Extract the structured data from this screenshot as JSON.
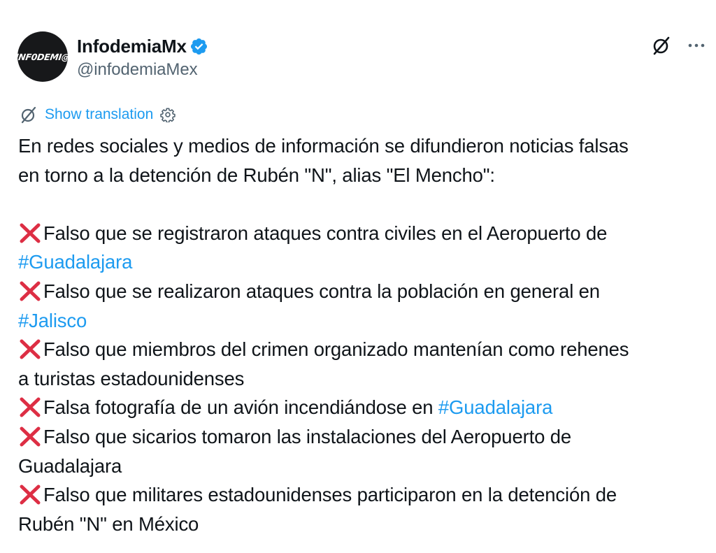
{
  "author": {
    "display_name": "InfodemiaMx",
    "handle": "@infodemiaMex",
    "avatar_text": "INF0DEMI@",
    "verified": true,
    "verified_icon": "verified-badge-icon",
    "verified_color": "#1d9bf0"
  },
  "actions": {
    "grok_icon": "grok-slash-circle-icon",
    "more_icon": "more-horizontal-icon"
  },
  "translation": {
    "label": "Show translation",
    "icon": "translate-slash-circle-icon",
    "settings_icon": "gear-icon",
    "color": "#1d9bf0"
  },
  "post": {
    "intro_line1": "En redes sociales y medios de información se difundieron noticias falsas",
    "intro_line2": "en torno a la detención de Rubén \"N\", alias \"El Mencho\":",
    "items": [
      {
        "line1": "Falso que se registraron ataques contra civiles en el Aeropuerto de",
        "hashtag_line2": "#Guadalajara"
      },
      {
        "line1": "Falso que se realizaron ataques contra la población en general en",
        "hashtag_line2": "#Jalisco"
      },
      {
        "line1": "Falso que miembros del crimen organizado mantenían como rehenes",
        "line2": "a turistas estadounidenses"
      },
      {
        "line1_prefix": "Falsa fotografía de un avión incendiándose en ",
        "hashtag_inline": "#Guadalajara"
      },
      {
        "line1": "Falso que sicarios tomaron las instalaciones del Aeropuerto de",
        "line2": "Guadalajara"
      },
      {
        "line1": "Falso que militares estadounidenses participaron en la detención de",
        "line2": "Rubén \"N\" en México"
      }
    ],
    "bullet_icon": "red-cross-mark-icon",
    "bullet_color": "#dd2e44",
    "hashtag_color": "#1d9bf0"
  }
}
